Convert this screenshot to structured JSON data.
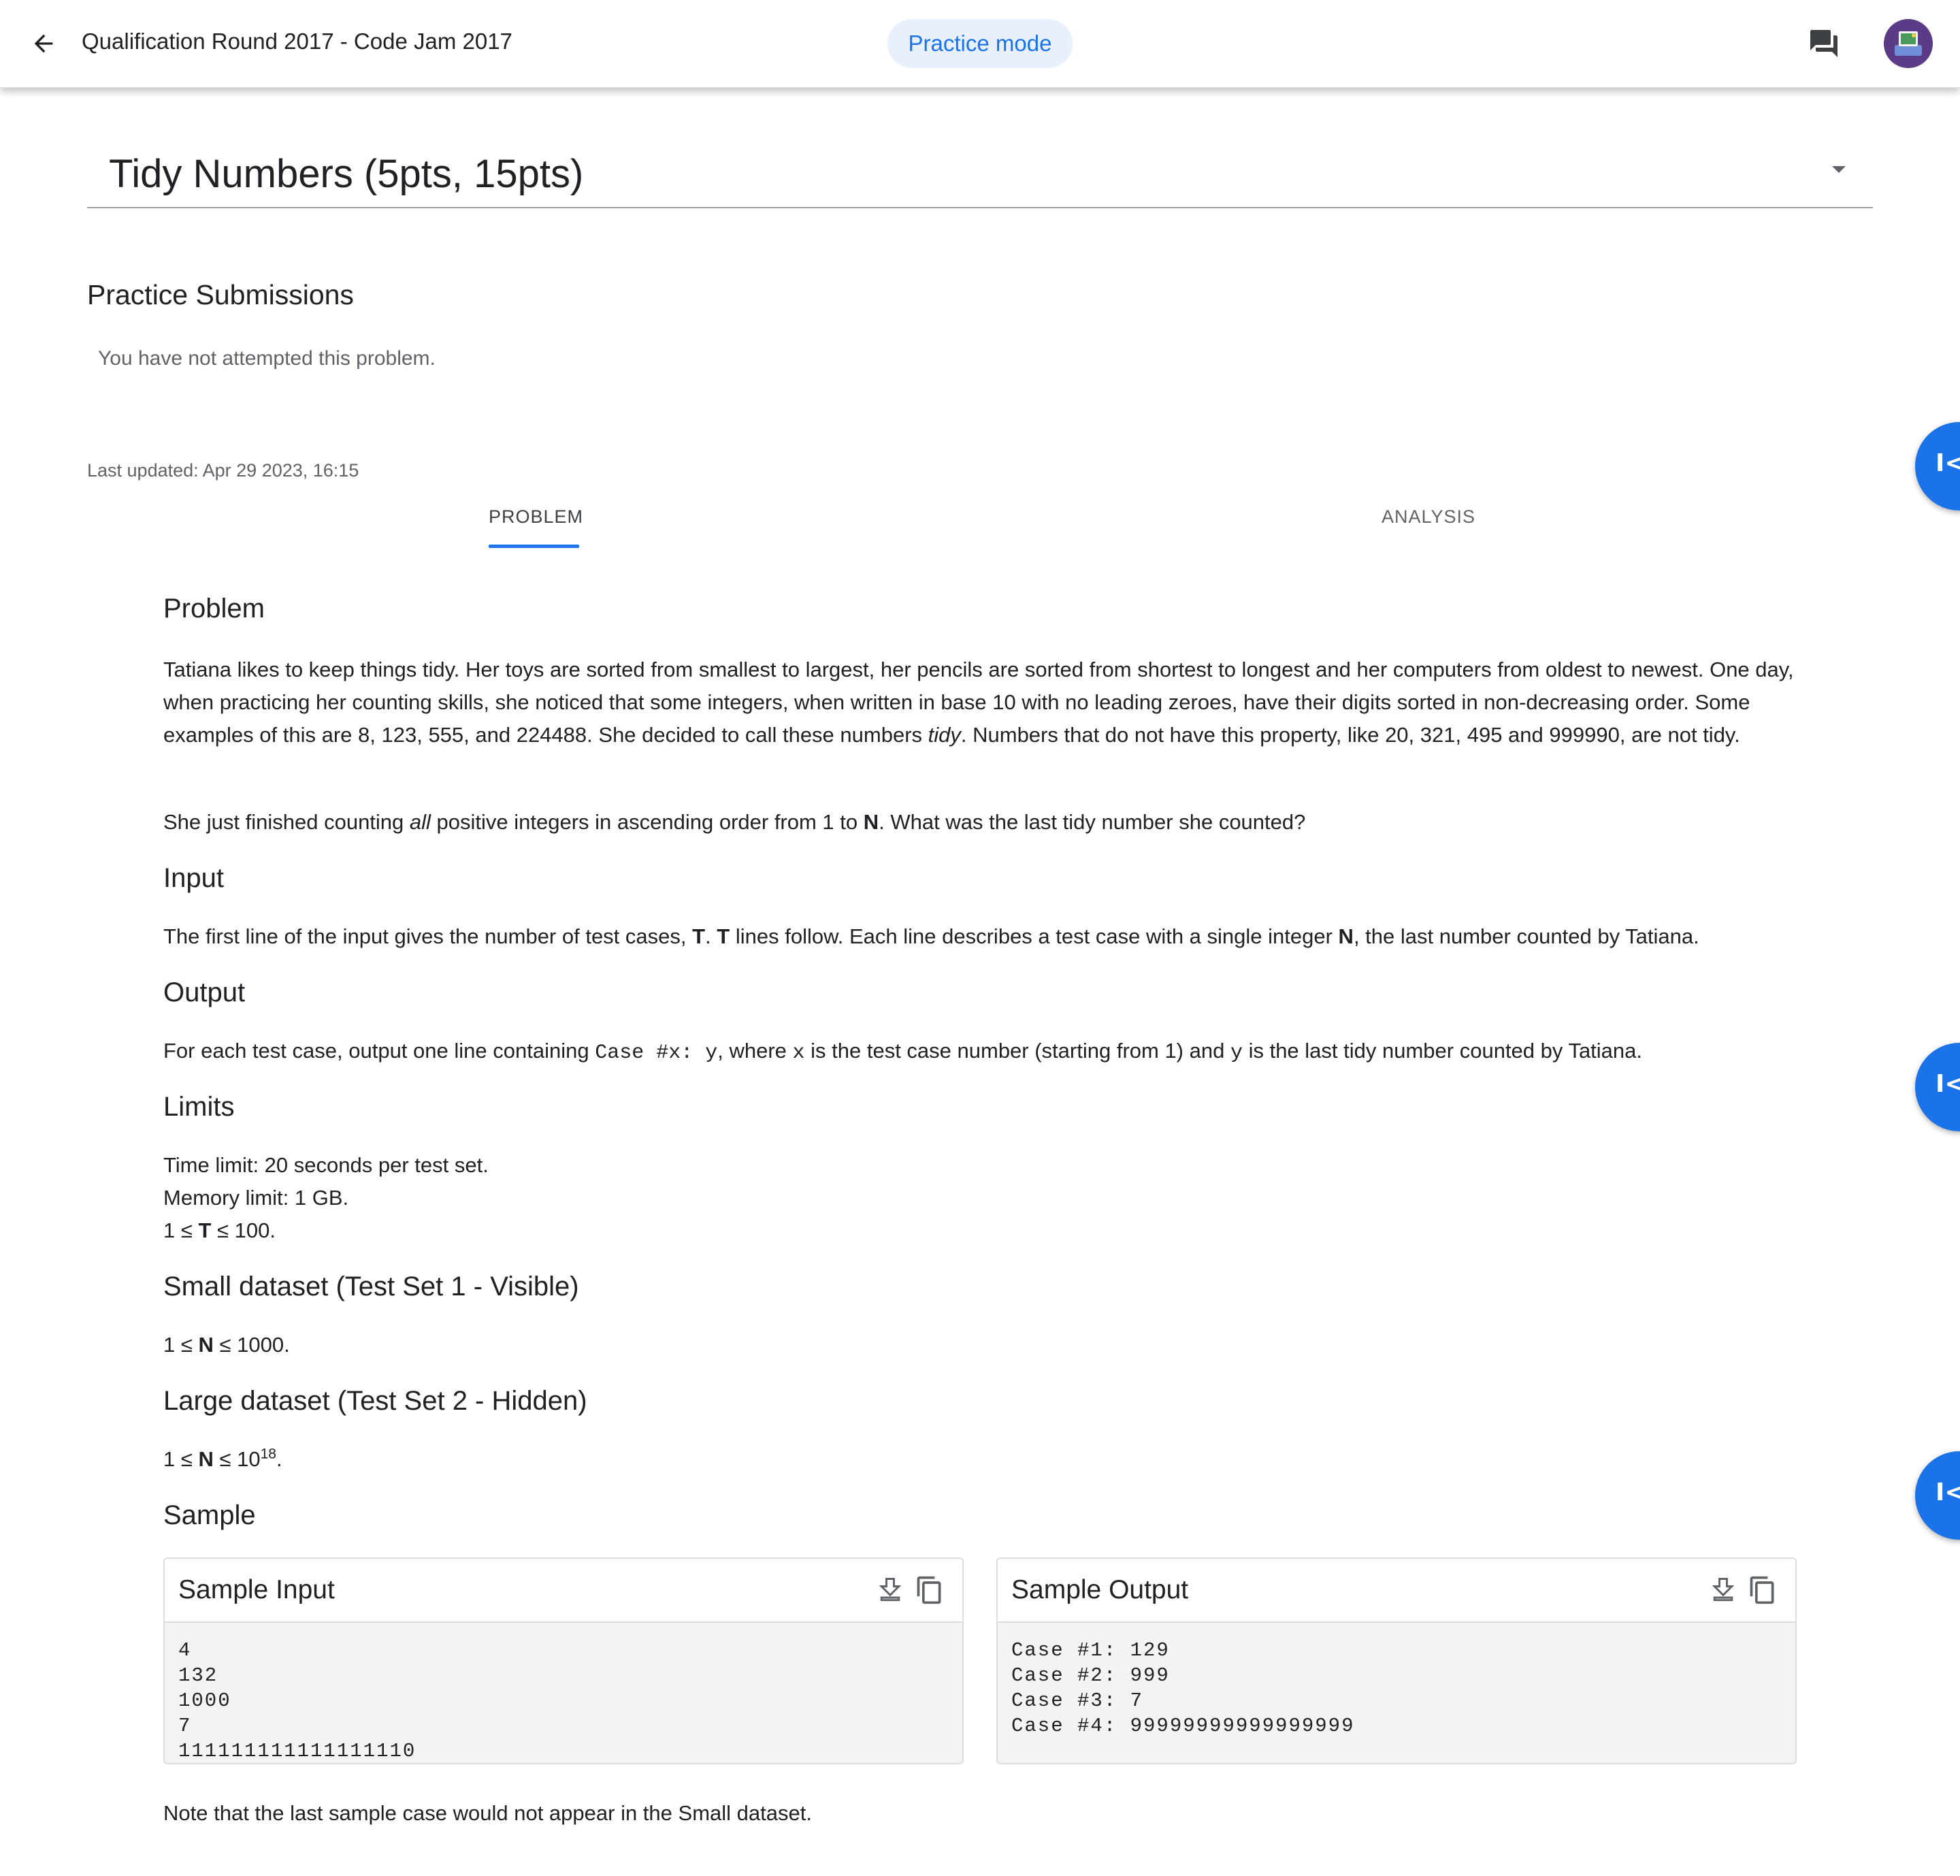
{
  "header": {
    "contest_title": "Qualification Round 2017 - Code Jam 2017",
    "mode_chip": "Practice mode"
  },
  "problem_selector": {
    "selected": "Tidy Numbers (5pts, 15pts)"
  },
  "submissions": {
    "title": "Practice Submissions",
    "status": "You have not attempted this problem."
  },
  "last_updated": "Last updated: Apr 29 2023, 16:15",
  "tabs": [
    {
      "label": "PROBLEM",
      "active": true
    },
    {
      "label": "ANALYSIS",
      "active": false
    }
  ],
  "fab_glyph": "I<",
  "problem": {
    "h_problem": "Problem",
    "desc_1": "Tatiana likes to keep things tidy. Her toys are sorted from smallest to largest, her pencils are sorted from shortest to longest and her computers from oldest to newest. One day, when practicing her counting skills, she noticed that some integers, when written in base 10 with no leading zeroes, have their digits sorted in non-decreasing order. Some examples of this are 8, 123, 555, and 224488. She decided to call these numbers ",
    "desc_tidy": "tidy",
    "desc_2": ". Numbers that do not have this property, like 20, 321, 495 and 999990, are not tidy.",
    "finish_1": "She just finished counting ",
    "finish_all": "all",
    "finish_2": " positive integers in ascending order from 1 to ",
    "finish_N": "N",
    "finish_3": ". What was the last tidy number she counted?",
    "h_input": "Input",
    "input_1": "The first line of the input gives the number of test cases, ",
    "input_T1": "T",
    "input_2": ". ",
    "input_T2": "T",
    "input_3": " lines follow. Each line describes a test case with a single integer ",
    "input_N": "N",
    "input_4": ", the last number counted by Tatiana.",
    "h_output": "Output",
    "output_1": "For each test case, output one line containing ",
    "output_code": "Case #x: y",
    "output_2": ", where ",
    "output_x": "x",
    "output_3": " is the test case number (starting from 1) and ",
    "output_y": "y",
    "output_4": " is the last tidy number counted by Tatiana.",
    "h_limits": "Limits",
    "limit_time": "Time limit: 20 seconds per test set.",
    "limit_memory": "Memory limit: 1 GB.",
    "limit_t_pre": "1 ≤ ",
    "limit_t_var": "T",
    "limit_t_post": " ≤ 100.",
    "h_small": "Small dataset (Test Set 1 - Visible)",
    "small_pre": "1 ≤ ",
    "small_var": "N",
    "small_post": " ≤ 1000.",
    "h_large": "Large dataset (Test Set 2 - Hidden)",
    "large_pre": "1 ≤ ",
    "large_var": "N",
    "large_mid": " ≤ 10",
    "large_exp": "18",
    "large_post": ".",
    "h_sample": "Sample",
    "note": "Note that the last sample case would not appear in the Small dataset."
  },
  "sample_input": {
    "title": "Sample Input",
    "content": "4\n132\n1000\n7\n111111111111111110"
  },
  "sample_output": {
    "title": "Sample Output",
    "content": "Case #1: 129\nCase #2: 999\nCase #3: 7\nCase #4: 99999999999999999"
  },
  "colors": {
    "accent": "#1a73e8",
    "chip_bg": "#e8f0fe",
    "text": "#202124",
    "muted": "#5f6368"
  }
}
